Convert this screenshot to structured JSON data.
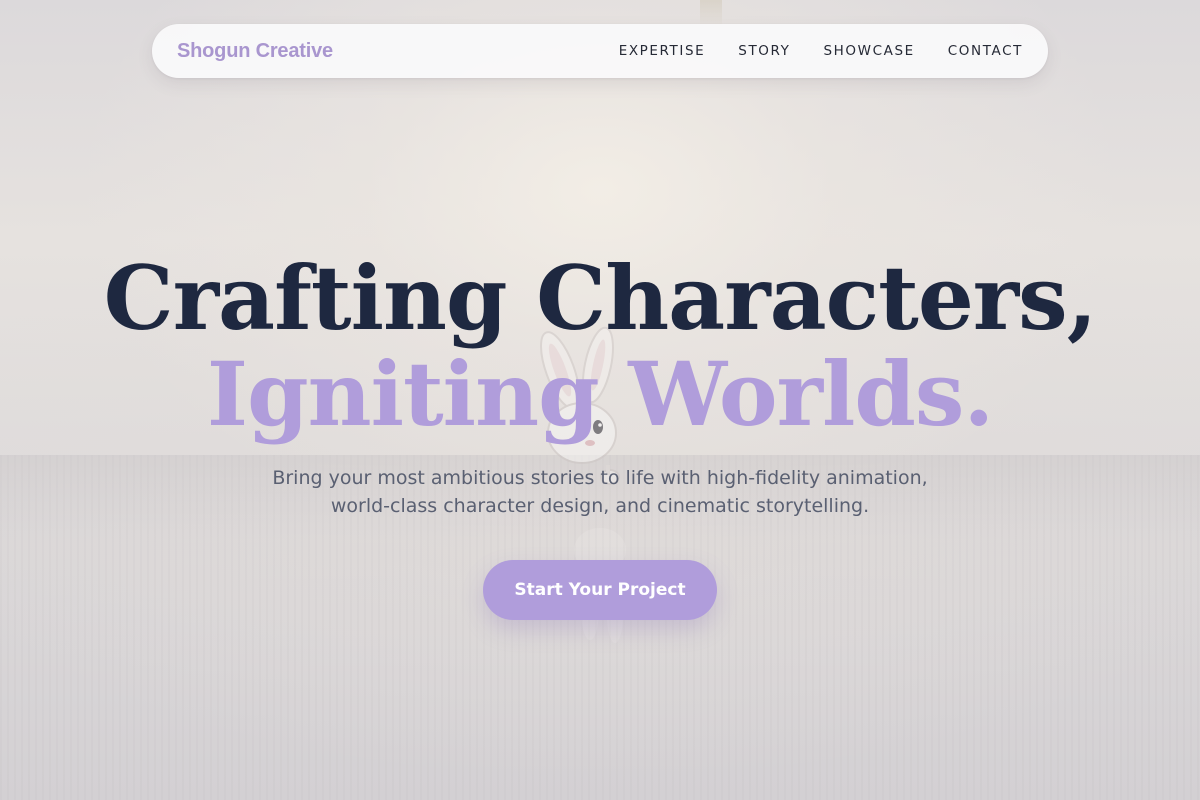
{
  "nav": {
    "brand": "Shogun Creative",
    "links": [
      {
        "label": "EXPERTISE"
      },
      {
        "label": "STORY"
      },
      {
        "label": "SHOWCASE"
      },
      {
        "label": "CONTACT"
      }
    ]
  },
  "hero": {
    "headline_line1": "Crafting Characters,",
    "headline_line2": "Igniting Worlds.",
    "subtitle_line1": "Bring your most ambitious stories to life with high-fidelity animation,",
    "subtitle_line2": "world-class character design, and cinematic storytelling.",
    "cta_label": "Start Your Project",
    "background_image": "bunny-character-scene"
  },
  "colors": {
    "accent": "#b09ddb",
    "brand": "#a996cf",
    "headline": "#1e2840",
    "body_text": "#5a6072",
    "nav_text": "#262a36"
  }
}
